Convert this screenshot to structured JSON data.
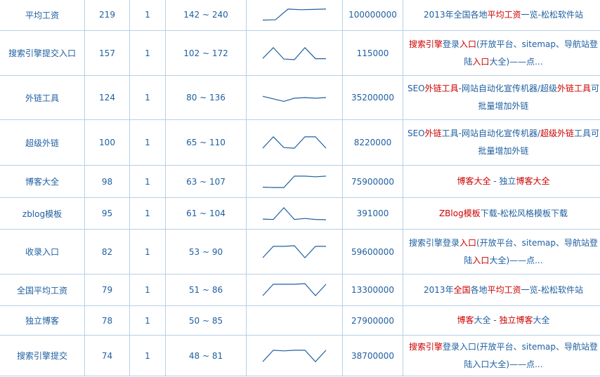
{
  "colors": {
    "text": "#1f5fa0",
    "highlight": "#cc0000",
    "border": "#b7d0e6",
    "spark": "#1f5fa0"
  },
  "rows": [
    {
      "keyword": "平均工资",
      "index": "219",
      "one": "1",
      "range": "142 ~ 240",
      "volume": "100000000",
      "trend": [
        0.08,
        0.1,
        0.95,
        0.9,
        0.92,
        0.95
      ],
      "title": [
        {
          "t": "2013年全国各地"
        },
        {
          "t": "平均工资",
          "hl": true
        },
        {
          "t": "一览-松松软件站"
        }
      ]
    },
    {
      "keyword": "搜索引擎提交入口",
      "index": "157",
      "one": "1",
      "range": "102 ~ 172",
      "volume": "115000",
      "trend": [
        0.1,
        0.95,
        0.05,
        0.0,
        0.95,
        0.08,
        0.08
      ],
      "title": [
        {
          "t": "搜索引擎",
          "hl": true
        },
        {
          "t": "登录"
        },
        {
          "t": "入口",
          "hl": true
        },
        {
          "t": "(开放平台、sitemap、导航站登陆"
        },
        {
          "t": "入口",
          "hl": true
        },
        {
          "t": "大全)——点..."
        }
      ]
    },
    {
      "keyword": "外链工具",
      "index": "124",
      "one": "1",
      "range": "80 ~ 136",
      "volume": "35200000",
      "trend": [
        0.6,
        0.4,
        0.2,
        0.45,
        0.5,
        0.45,
        0.5
      ],
      "title": [
        {
          "t": "SEO"
        },
        {
          "t": "外链工具",
          "hl": true
        },
        {
          "t": "-网站自动化宣传机器/超级"
        },
        {
          "t": "外链工具",
          "hl": true
        },
        {
          "t": "可批量增加外链"
        }
      ]
    },
    {
      "keyword": "超级外链",
      "index": "100",
      "one": "1",
      "range": "65 ~ 110",
      "volume": "8220000",
      "trend": [
        0.05,
        0.95,
        0.1,
        0.05,
        0.95,
        0.95,
        0.05
      ],
      "title": [
        {
          "t": "SEO"
        },
        {
          "t": "外链",
          "hl": true
        },
        {
          "t": "工具-网站自动化宣传机器/"
        },
        {
          "t": "超级外链",
          "hl": true
        },
        {
          "t": "工具可批量增加外链"
        }
      ]
    },
    {
      "keyword": "博客大全",
      "index": "98",
      "one": "1",
      "range": "63 ~ 107",
      "volume": "75900000",
      "trend": [
        0.08,
        0.05,
        0.05,
        0.95,
        0.95,
        0.9,
        0.95
      ],
      "title": [
        {
          "t": "博客大全",
          "hl": true
        },
        {
          "t": " - 独立"
        },
        {
          "t": "博客大全",
          "hl": true
        }
      ]
    },
    {
      "keyword": "zblog模板",
      "index": "95",
      "one": "1",
      "range": "61 ~ 104",
      "volume": "391000",
      "trend": [
        0.05,
        0.02,
        0.95,
        0.02,
        0.1,
        0.02,
        0.0
      ],
      "title": [
        {
          "t": "ZBlog模板",
          "hl": true
        },
        {
          "t": "下载-松松风格模板下载"
        }
      ]
    },
    {
      "keyword": "收录入口",
      "index": "82",
      "one": "1",
      "range": "53 ~ 90",
      "volume": "59600000",
      "trend": [
        0.05,
        0.95,
        0.95,
        1.0,
        0.05,
        0.95,
        0.95
      ],
      "title": [
        {
          "t": "搜索引擎登录"
        },
        {
          "t": "入口",
          "hl": true
        },
        {
          "t": "(开放平台、sitemap、导航站登陆"
        },
        {
          "t": "入口",
          "hl": true
        },
        {
          "t": "大全)——点..."
        }
      ]
    },
    {
      "keyword": "全国平均工资",
      "index": "79",
      "one": "1",
      "range": "51 ~ 86",
      "volume": "13300000",
      "trend": [
        0.05,
        0.95,
        0.95,
        0.95,
        1.0,
        0.05,
        0.95
      ],
      "title": [
        {
          "t": "2013年"
        },
        {
          "t": "全国",
          "hl": true
        },
        {
          "t": "各地"
        },
        {
          "t": "平均工资",
          "hl": true
        },
        {
          "t": "一览-松松软件站"
        }
      ]
    },
    {
      "keyword": "独立博客",
      "index": "78",
      "one": "1",
      "range": "50 ~ 85",
      "volume": "27900000",
      "trend": [],
      "title": [
        {
          "t": "博客",
          "hl": true
        },
        {
          "t": "大全 - "
        },
        {
          "t": "独立博客",
          "hl": true
        },
        {
          "t": "大全"
        }
      ]
    },
    {
      "keyword": "搜索引擎提交",
      "index": "74",
      "one": "1",
      "range": "48 ~ 81",
      "volume": "38700000",
      "trend": [
        0.05,
        0.95,
        0.9,
        0.95,
        0.95,
        0.05,
        0.95
      ],
      "title": [
        {
          "t": "搜索引擎",
          "hl": true
        },
        {
          "t": "登录入口(开放平台、sitemap、导航站登陆入口大全)——点..."
        }
      ]
    }
  ]
}
